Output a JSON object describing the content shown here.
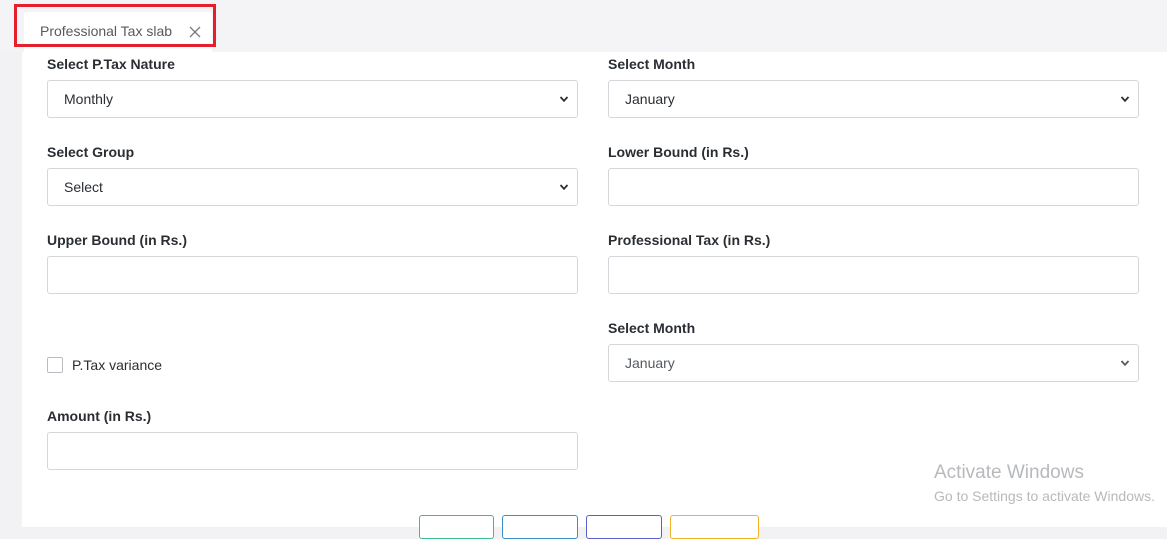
{
  "tab": {
    "label": "Professional Tax slab",
    "close_icon": "close-icon"
  },
  "form": {
    "ptax_nature": {
      "label": "Select P.Tax Nature",
      "value": "Monthly"
    },
    "month": {
      "label": "Select Month",
      "value": "January"
    },
    "group": {
      "label": "Select Group",
      "value": "Select"
    },
    "lower_bound": {
      "label": "Lower Bound (in Rs.)",
      "value": ""
    },
    "upper_bound": {
      "label": "Upper Bound (in Rs.)",
      "value": ""
    },
    "professional_tax": {
      "label": "Professional Tax (in Rs.)",
      "value": ""
    },
    "variance_month": {
      "label": "Select Month",
      "value": "January"
    },
    "variance": {
      "label": "P.Tax variance",
      "checked": false
    },
    "amount": {
      "label": "Amount (in Rs.)",
      "value": ""
    }
  },
  "colors": {
    "highlight": "#e3202b",
    "btn_save": "#3bbf8a",
    "btn_view": "#3b8fc9",
    "btn_print": "#5b5fc7",
    "btn_reset": "#f0b429"
  },
  "watermark": {
    "title": "Activate Windows",
    "subtitle": "Go to Settings to activate Windows."
  }
}
